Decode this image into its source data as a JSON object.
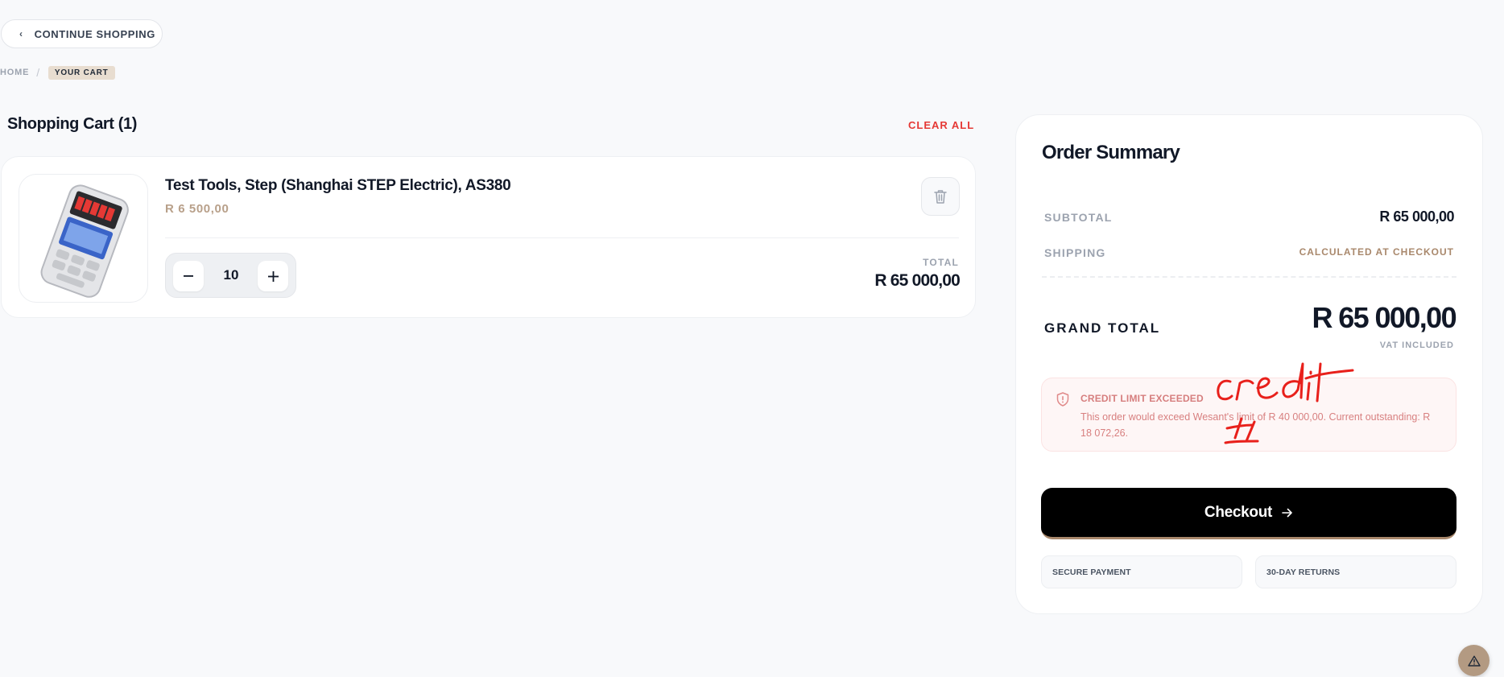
{
  "nav": {
    "continue_label": "CONTINUE SHOPPING",
    "continue_icon": "chevron-left-icon"
  },
  "breadcrumb": {
    "home": "HOME",
    "separator": "/",
    "current": "YOUR CART"
  },
  "cart": {
    "title": "Shopping Cart (1)",
    "clear_all": "CLEAR ALL",
    "items": [
      {
        "name": "Test Tools, Step (Shanghai STEP Electric), AS380",
        "unit_price": "R 6 500,00",
        "quantity": "10",
        "total_label": "TOTAL",
        "total_value": "R 65 000,00",
        "image": "handheld-controller-image",
        "delete_icon": "trash-icon"
      }
    ]
  },
  "summary": {
    "title": "Order Summary",
    "subtotal_label": "SUBTOTAL",
    "subtotal_value": "R 65 000,00",
    "shipping_label": "SHIPPING",
    "shipping_value": "CALCULATED AT CHECKOUT",
    "grand_total_label": "GRAND TOTAL",
    "grand_total_value": "R 65 000,00",
    "vat_note": "VAT INCLUDED",
    "alert": {
      "icon": "shield-alert-icon",
      "title": "CREDIT LIMIT EXCEEDED",
      "message": "This order would exceed Wesant's limit of R 40 000,00. Current outstanding: R 18 072,26."
    },
    "checkout_label": "Checkout",
    "checkout_icon": "arrow-right-icon",
    "trust_badges": [
      "SECURE PAYMENT",
      "30-DAY RETURNS"
    ]
  },
  "help_button_icon": "warning-triangle-icon",
  "colors": {
    "background": "#f8f9fb",
    "accent_tan": "#a9886c",
    "danger": "#e53935",
    "checkout_bg": "#000000",
    "annotation_red": "#e8201b"
  }
}
